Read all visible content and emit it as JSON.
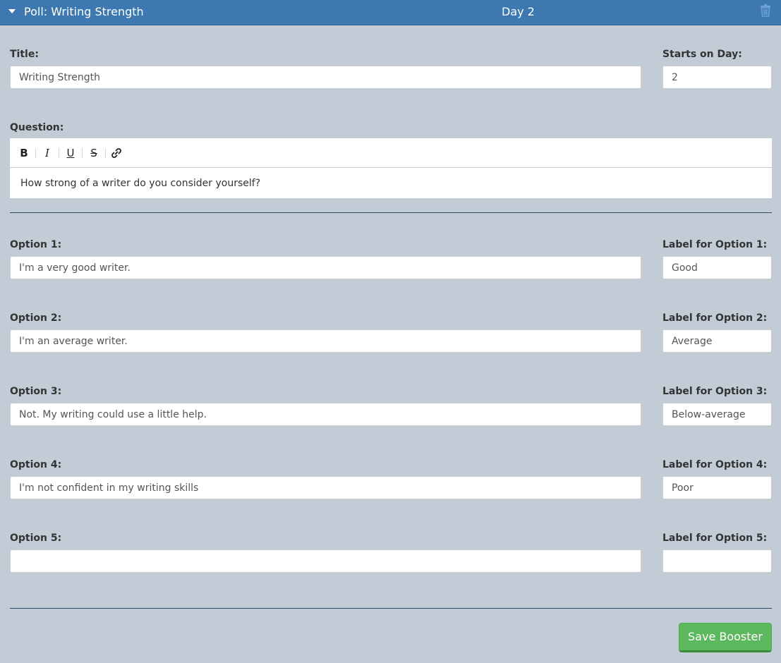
{
  "header": {
    "title": "Poll: Writing Strength",
    "day": "Day 2",
    "icons": {
      "collapse": "caret-down-icon",
      "delete": "trash-icon"
    }
  },
  "form": {
    "title_label": "Title:",
    "title_value": "Writing Strength",
    "start_day_label": "Starts on Day:",
    "start_day_value": "2",
    "question_label": "Question:",
    "question_value": "How strong of a writer do you consider yourself?",
    "toolbar": [
      "B",
      "I",
      "U",
      "S",
      "link-icon"
    ],
    "options": [
      {
        "label": "Option 1:",
        "value": "I'm a very good writer.",
        "tag_label": "Label for Option 1:",
        "tag_value": "Good"
      },
      {
        "label": "Option 2:",
        "value": "I'm an average writer.",
        "tag_label": "Label for Option 2:",
        "tag_value": "Average"
      },
      {
        "label": "Option 3:",
        "value": "Not. My writing could use a little help.",
        "tag_label": "Label for Option 3:",
        "tag_value": "Below-average"
      },
      {
        "label": "Option 4:",
        "value": "I'm not confident in my writing skills",
        "tag_label": "Label for Option 4:",
        "tag_value": "Poor"
      },
      {
        "label": "Option 5:",
        "value": "",
        "tag_label": "Label for Option 5:",
        "tag_value": ""
      }
    ],
    "save_label": "Save Booster"
  },
  "colors": {
    "header_bg": "#3d78b0",
    "page_bg": "#c1ccd7",
    "save_button": "#5cb85c"
  }
}
